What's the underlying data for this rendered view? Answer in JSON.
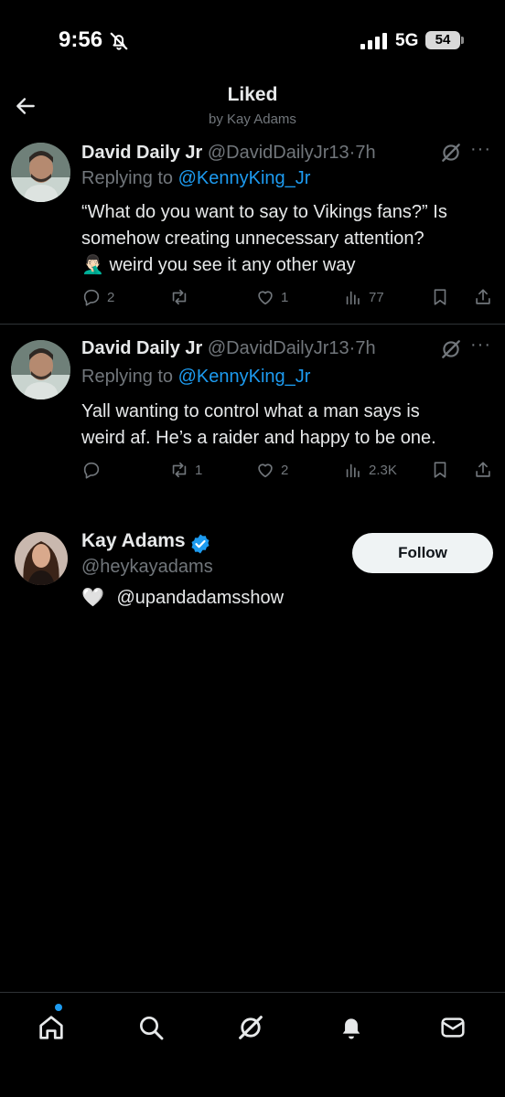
{
  "status_bar": {
    "time": "9:56",
    "network": "5G",
    "battery": "54"
  },
  "header": {
    "title": "Liked",
    "subtitle": "by Kay Adams"
  },
  "tweets": [
    {
      "name": "David Daily Jr",
      "handle": "@DavidDailyJr13",
      "dot": "·",
      "time": "7h",
      "replying_prefix": "Replying to ",
      "replying_to": "@KennyKing_Jr",
      "text_lines": [
        "“What do you want to say to Vikings fans?” Is",
        "somehow creating unnecessary attention?",
        "🤦🏻‍♂️ weird you see it any other way"
      ],
      "replies": "2",
      "reposts": "",
      "likes": "1",
      "views": "77"
    },
    {
      "name": "David Daily Jr",
      "handle": "@DavidDailyJr13",
      "dot": "·",
      "time": "7h",
      "replying_prefix": "Replying to ",
      "replying_to": "@KennyKing_Jr",
      "text_lines": [
        "Yall wanting to control what a man says is",
        "weird af. He’s a raider and happy to be one."
      ],
      "replies": "",
      "reposts": "1",
      "likes": "2",
      "views": "2.3K"
    }
  ],
  "user": {
    "name": "Kay Adams",
    "handle": "@heykayadams",
    "bio_emoji": "🤍",
    "bio": "@upandadamsshow",
    "follow_label": "Follow"
  },
  "colors": {
    "accent": "#1d9bf0",
    "muted": "#71767b",
    "text": "#e7e9ea",
    "divider": "#2f3336"
  },
  "nav_icons": [
    "home-icon",
    "search-icon",
    "grok-icon",
    "notifications-icon",
    "messages-icon"
  ]
}
